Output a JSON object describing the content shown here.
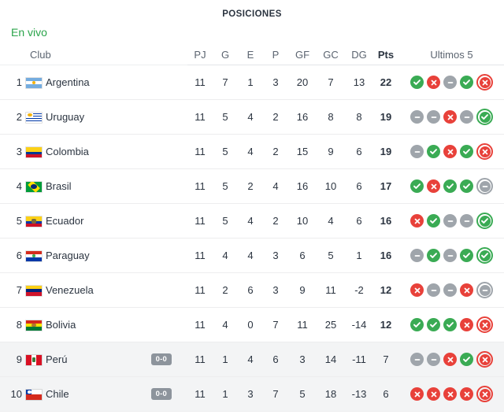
{
  "header": {
    "title": "POSICIONES",
    "live_label": "En vivo"
  },
  "columns": {
    "club": "Club",
    "pj": "PJ",
    "g": "G",
    "e": "E",
    "p": "P",
    "gf": "GF",
    "gc": "GC",
    "dg": "DG",
    "pts": "Pts",
    "last5": "Ultimos 5"
  },
  "colors": {
    "live_green": "#2aa44a",
    "win": "#3aab54",
    "loss": "#e8413a",
    "draw": "#9fa5ab",
    "badge_gray": "#8d949c",
    "text": "#2b3440",
    "row_live_bg": "#f3f4f5"
  },
  "rows": [
    {
      "rank": "1",
      "team": "Argentina",
      "flag": "flag-argentina",
      "score_badge": null,
      "pj": "11",
      "g": "7",
      "e": "1",
      "p": "3",
      "gf": "20",
      "gc": "7",
      "dg": "13",
      "pts": "22",
      "pts_bold": true,
      "live": false,
      "last5": [
        "win",
        "loss",
        "draw",
        "win",
        "loss"
      ]
    },
    {
      "rank": "2",
      "team": "Uruguay",
      "flag": "flag-uruguay",
      "score_badge": null,
      "pj": "11",
      "g": "5",
      "e": "4",
      "p": "2",
      "gf": "16",
      "gc": "8",
      "dg": "8",
      "pts": "19",
      "pts_bold": true,
      "live": false,
      "last5": [
        "draw",
        "draw",
        "loss",
        "draw",
        "win"
      ]
    },
    {
      "rank": "3",
      "team": "Colombia",
      "flag": "flag-colombia",
      "score_badge": null,
      "pj": "11",
      "g": "5",
      "e": "4",
      "p": "2",
      "gf": "15",
      "gc": "9",
      "dg": "6",
      "pts": "19",
      "pts_bold": true,
      "live": false,
      "last5": [
        "draw",
        "win",
        "loss",
        "win",
        "loss"
      ]
    },
    {
      "rank": "4",
      "team": "Brasil",
      "flag": "flag-brasil",
      "score_badge": null,
      "pj": "11",
      "g": "5",
      "e": "2",
      "p": "4",
      "gf": "16",
      "gc": "10",
      "dg": "6",
      "pts": "17",
      "pts_bold": true,
      "live": false,
      "last5": [
        "win",
        "loss",
        "win",
        "win",
        "draw"
      ]
    },
    {
      "rank": "5",
      "team": "Ecuador",
      "flag": "flag-ecuador",
      "score_badge": null,
      "pj": "11",
      "g": "5",
      "e": "4",
      "p": "2",
      "gf": "10",
      "gc": "4",
      "dg": "6",
      "pts": "16",
      "pts_bold": true,
      "live": false,
      "last5": [
        "loss",
        "win",
        "draw",
        "draw",
        "win"
      ]
    },
    {
      "rank": "6",
      "team": "Paraguay",
      "flag": "flag-paraguay",
      "score_badge": null,
      "pj": "11",
      "g": "4",
      "e": "4",
      "p": "3",
      "gf": "6",
      "gc": "5",
      "dg": "1",
      "pts": "16",
      "pts_bold": true,
      "live": false,
      "last5": [
        "draw",
        "win",
        "draw",
        "win",
        "win"
      ]
    },
    {
      "rank": "7",
      "team": "Venezuela",
      "flag": "flag-venezuela",
      "score_badge": null,
      "pj": "11",
      "g": "2",
      "e": "6",
      "p": "3",
      "gf": "9",
      "gc": "11",
      "dg": "-2",
      "pts": "12",
      "pts_bold": true,
      "live": false,
      "last5": [
        "loss",
        "draw",
        "draw",
        "loss",
        "draw"
      ]
    },
    {
      "rank": "8",
      "team": "Bolivia",
      "flag": "flag-bolivia",
      "score_badge": null,
      "pj": "11",
      "g": "4",
      "e": "0",
      "p": "7",
      "gf": "11",
      "gc": "25",
      "dg": "-14",
      "pts": "12",
      "pts_bold": true,
      "live": false,
      "last5": [
        "win",
        "win",
        "win",
        "loss",
        "loss"
      ]
    },
    {
      "rank": "9",
      "team": "Perú",
      "flag": "flag-peru",
      "score_badge": "0-0",
      "pj": "11",
      "g": "1",
      "e": "4",
      "p": "6",
      "gf": "3",
      "gc": "14",
      "dg": "-11",
      "pts": "7",
      "pts_bold": false,
      "live": true,
      "last5": [
        "draw",
        "draw",
        "loss",
        "win",
        "loss"
      ]
    },
    {
      "rank": "10",
      "team": "Chile",
      "flag": "flag-chile",
      "score_badge": "0-0",
      "pj": "11",
      "g": "1",
      "e": "3",
      "p": "7",
      "gf": "5",
      "gc": "18",
      "dg": "-13",
      "pts": "6",
      "pts_bold": false,
      "live": true,
      "last5": [
        "loss",
        "loss",
        "loss",
        "loss",
        "loss"
      ]
    }
  ]
}
